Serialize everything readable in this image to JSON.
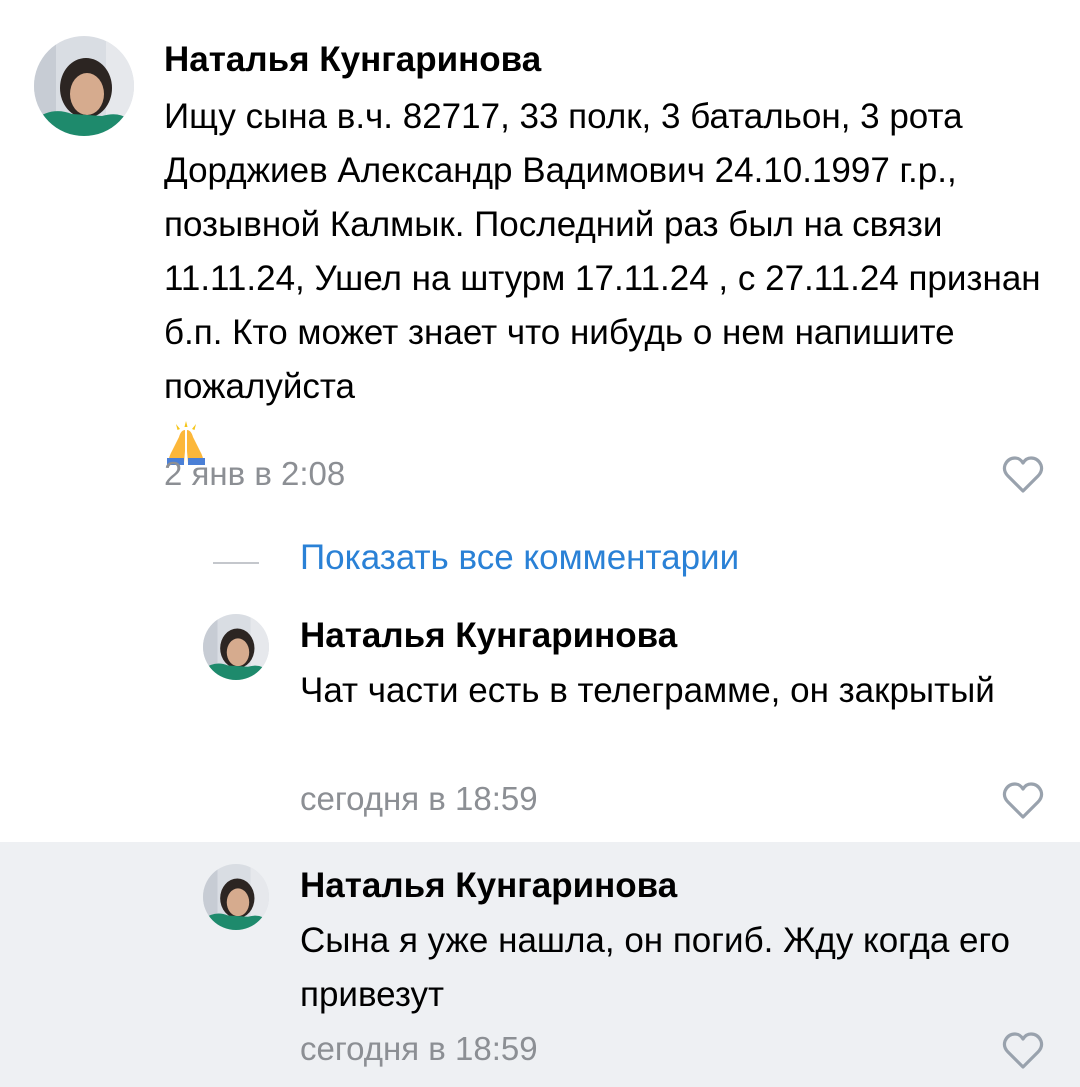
{
  "main_comment": {
    "author": "Наталья Кунгаринова",
    "text": "Ищу сына в.ч. 82717, 33 полк, 3 батальон, 3 рота Дорджиев Александр Вадимович 24.10.1997 г.р., позывной Калмык. Последний раз был на связи 11.11.24, Ушел на штурм 17.11.24 , с 27.11.24 признан б.п. Кто может знает что нибудь о нем напишите пожалуйста",
    "emoji": "folded-hands-emoji",
    "time": "2 янв в 2:08",
    "like_icon": "heart-outline-icon"
  },
  "show_all": {
    "label": "Показать все комментарии",
    "color": "#2a81d6"
  },
  "replies": [
    {
      "author": "Наталья Кунгаринова",
      "text": "Чат части есть в телеграмме, он закрытый",
      "time": "сегодня в 18:59",
      "like_icon": "heart-outline-icon"
    },
    {
      "author": "Наталья Кунгаринова",
      "text": "Сына я уже нашла, он погиб. Жду когда его привезут",
      "time": "сегодня в 18:59",
      "like_icon": "heart-outline-icon",
      "highlight_color": "#eef0f3"
    }
  ],
  "colors": {
    "meta_text": "#8c8f94",
    "like_icon": "#99a2ad"
  }
}
